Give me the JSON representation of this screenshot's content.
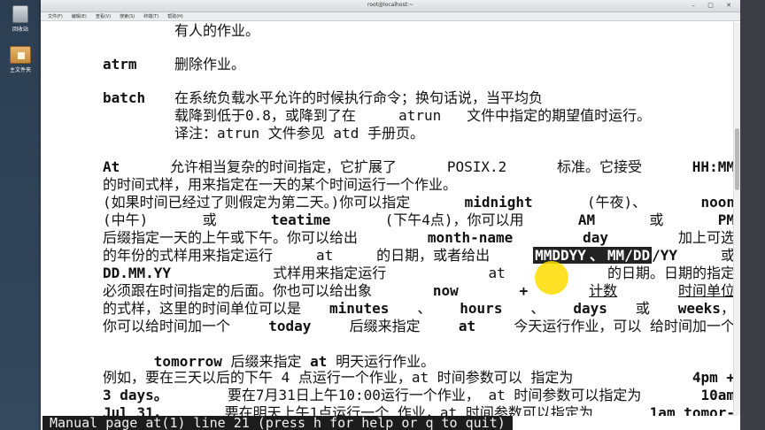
{
  "desktop": {
    "icons": [
      {
        "label": "回收站",
        "icon": "trash-icon"
      },
      {
        "label": "主文件夹",
        "icon": "home-folder-icon"
      }
    ]
  },
  "window": {
    "title": "root@localhost:~",
    "controls": [
      "–",
      "□",
      "✕"
    ],
    "menus": [
      "文件(F)",
      "编辑(E)",
      "查看(V)",
      "搜索(S)",
      "终端(T)",
      "帮助(H)"
    ]
  },
  "terminal": {
    "line0": "有人的作业。",
    "atrm_cmd": "atrm",
    "atrm_desc": "删除作业。",
    "batch_cmd": "batch",
    "batch_desc1": "在系统负载水平允许的时候执行命令；换句话说，当平均负",
    "batch_desc2": "载降到低于0.8，或降到了在     atrun   文件中指定的期望值时运行。",
    "batch_desc3": "译注：atrun 文件参见 atd 手册页。",
    "p1_at": "At",
    "p1_a": "允许相当复杂的时间指定，它扩展了",
    "p1_posix": "POSIX.2",
    "p1_b": "标准。它接受",
    "p1_hhmm": "HH:MM",
    "p2": "的时间式样，用来指定在一天的某个时间运行一个作业。",
    "p3_a": "(如果时间已经过了则假定为第二天。)你可以指定",
    "p3_midnight": "midnight",
    "p3_b": "(午夜)、",
    "p3_noon": "noon",
    "p4_a": "(中午)",
    "p4_or1": "或",
    "p4_teatime": "teatime",
    "p4_b": "(下午4点)，你可以用",
    "p4_am": "AM",
    "p4_or2": "或",
    "p4_pm": "PM",
    "p5_a": "后缀指定一天的上午或下午。你可以给出",
    "p5_monthname": "month-name",
    "p5_day": "day",
    "p5_b": "加上可选",
    "p6_a": "的年份的式样用来指定运行",
    "p6_at": "at",
    "p6_b": "的日期，或者给出",
    "p6_mmddyy": "MMDDYY",
    "p6_sep": "、",
    "p6_mmddyy2a": "MM/DD",
    "p6_mmddyy2b": "/YY",
    "p6_or": "或",
    "p7_ddmmyy": "DD.MM.YY",
    "p7_a": "式样用来指定运行",
    "p7_at": "at",
    "p7_b": "的日期。日期的指定",
    "p8_a": "必须跟在时间指定的后面。你也可以给出象",
    "p8_now": "now",
    "p8_plus": "+",
    "p8_count": "计数",
    "p8_unit": "时间单位",
    "p9_a": "的式样，这里的时间单位可以是",
    "p9_minutes": "minutes",
    "p9_s1": "、",
    "p9_hours": "hours",
    "p9_s2": "、",
    "p9_days": "days",
    "p9_or": "或",
    "p9_weeks": "weeks",
    "p9_end": "，",
    "p10_a": "你可以给时间加一个",
    "p10_today": "today",
    "p10_b": "后缀来指定",
    "p10_at": "at",
    "p10_c": "今天运行作业，可以 给时间加一个",
    "p11_tomorrow": "tomorrow",
    "p11_a": "后缀来指定",
    "p11_at": "at",
    "p11_b": "明天运行作业。",
    "p12_a": "例如，要在三天以后的下午 4 点运行一个作业，at 时间参数可以 指定为",
    "p12_val": "4pm +",
    "p13_val": "3  days。",
    "p13_a": "要在7月31日上午10:00运行一个作业，  at 时间参数可以指定为",
    "p13_val2": "10am",
    "p14_val": "Jul 31，",
    "p14_a": "要在明天上午1点运行一个  作业，at 时间参数可以指定为",
    "p14_val2": "1am tomor-"
  },
  "status": {
    "text": "Manual page at(1) line 21 (press h for help or q to quit)"
  }
}
